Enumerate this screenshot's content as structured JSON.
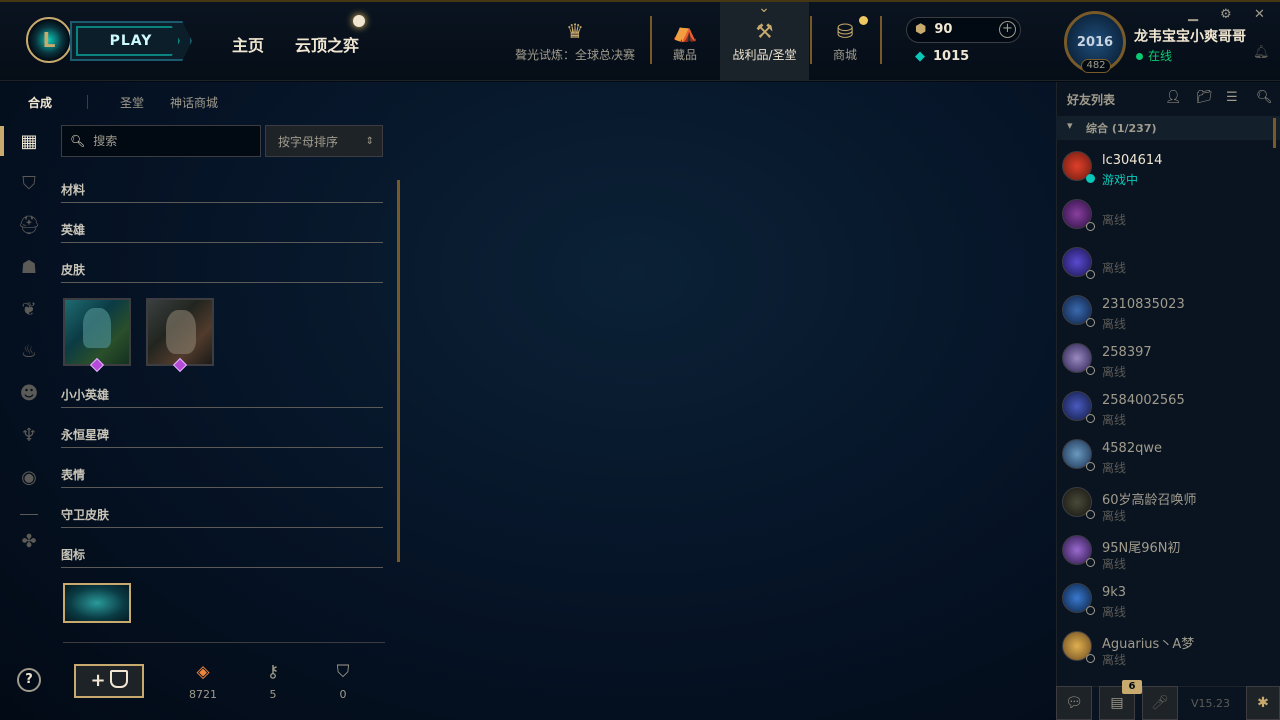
{
  "header": {
    "play_label": "PLAY",
    "logo_glyph": "L",
    "nav": [
      "主页",
      "云顶之弈"
    ],
    "event_label": "聱光试炼：全球总决赛",
    "icons": [
      {
        "name": "collection",
        "label": "藏品"
      },
      {
        "name": "loot",
        "label": "战利品/圣堂"
      },
      {
        "name": "store",
        "label": "商城"
      }
    ],
    "rp": "90",
    "be": "1015",
    "player_name": "龙韦宝宝小爽哥哥",
    "player_status": "在线",
    "avatar_text": "2016",
    "level": "482"
  },
  "subtabs": {
    "craft": "合成",
    "sanctum": "圣堂",
    "mythic": "神话商城"
  },
  "search": {
    "placeholder": "搜索"
  },
  "sort": {
    "label": "按字母排序"
  },
  "categories": {
    "materials": "材料",
    "champions": "英雄",
    "skins": "皮肤",
    "tacticians": "小小英雄",
    "eternals": "永恒星碑",
    "emotes": "表情",
    "ward_skins": "守卫皮肤",
    "icons": "图标"
  },
  "bottom": {
    "help": "?",
    "craft_btn": "+",
    "orange_essence": "8721",
    "keys": "5",
    "chests": "0"
  },
  "friends": {
    "title": "好友列表",
    "group": "综合 (1/237)",
    "list": [
      {
        "name": "lc304614",
        "status": "游戏中"
      },
      {
        "name": "",
        "status": "离线"
      },
      {
        "name": "",
        "status": "离线"
      },
      {
        "name": "2310835023",
        "status": "离线"
      },
      {
        "name": "258397",
        "status": "离线"
      },
      {
        "name": "2584002565",
        "status": "离线"
      },
      {
        "name": "4582qwe",
        "status": "离线"
      },
      {
        "name": "60岁高龄召唤师",
        "status": "离线"
      },
      {
        "name": "95N尾96N初",
        "status": "离线"
      },
      {
        "name": "9k3",
        "status": "离线"
      },
      {
        "name": "Aguarius丶A梦",
        "status": "离线"
      }
    ],
    "badge": "6",
    "version": "V15.23"
  },
  "colors": {
    "gold": "#c8aa6e",
    "teal": "#0ac8b9",
    "online": "#0acb73",
    "bg": "#010a13"
  }
}
